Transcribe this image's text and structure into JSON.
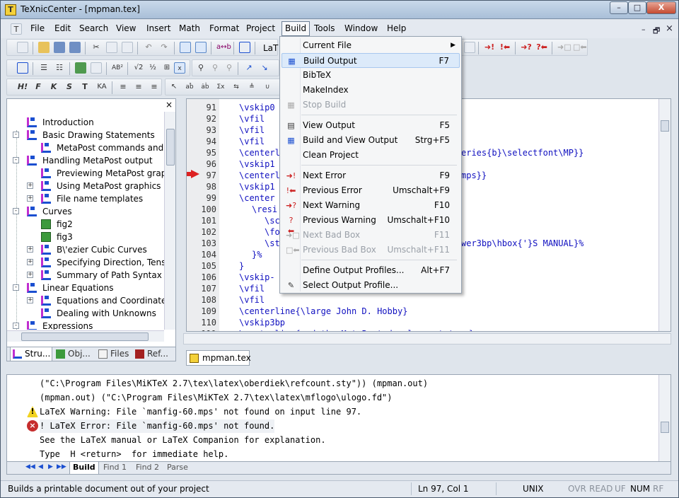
{
  "window": {
    "title": "TeXnicCenter - [mpman.tex]",
    "icon_letter": "T",
    "minimize": "–",
    "maximize": "□",
    "close": "X"
  },
  "menubar": {
    "items": [
      "File",
      "Edit",
      "Search",
      "View",
      "Insert",
      "Math",
      "Format",
      "Project",
      "Build",
      "Tools",
      "Window",
      "Help"
    ],
    "active": "Build",
    "mdi_minimize": "–",
    "mdi_restore": "🗗",
    "mdi_close": "×"
  },
  "toolbar": {
    "latex_combo": "LaT"
  },
  "build_menu": {
    "items": [
      {
        "label": "Current File",
        "key": "",
        "submenu": true,
        "disabled": false
      },
      {
        "label": "Build Output",
        "key": "F7",
        "highlighted": true,
        "disabled": false
      },
      {
        "label": "BibTeX",
        "key": "",
        "disabled": false
      },
      {
        "label": "MakeIndex",
        "key": "",
        "disabled": false
      },
      {
        "label": "Stop Build",
        "key": "",
        "disabled": true
      },
      {
        "label": "View Output",
        "key": "F5",
        "disabled": false
      },
      {
        "label": "Build and View Output",
        "key": "Strg+F5",
        "disabled": false
      },
      {
        "label": "Clean Project",
        "key": "",
        "disabled": false
      },
      {
        "label": "Next Error",
        "key": "F9",
        "disabled": false
      },
      {
        "label": "Previous Error",
        "key": "Umschalt+F9",
        "disabled": false
      },
      {
        "label": "Next Warning",
        "key": "F10",
        "disabled": false
      },
      {
        "label": "Previous Warning",
        "key": "Umschalt+F10",
        "disabled": false
      },
      {
        "label": "Next Bad Box",
        "key": "F11",
        "disabled": true
      },
      {
        "label": "Previous Bad Box",
        "key": "Umschalt+F11",
        "disabled": true
      },
      {
        "label": "Define Output Profiles...",
        "key": "Alt+F7",
        "disabled": false
      },
      {
        "label": "Select Output Profile...",
        "key": "",
        "disabled": false
      }
    ]
  },
  "structure": {
    "close": "×",
    "nodes": [
      {
        "label": "Introduction",
        "level": 1,
        "type": "section",
        "expander": ""
      },
      {
        "label": "Basic Drawing Statements",
        "level": 1,
        "type": "section",
        "expander": "-"
      },
      {
        "label": "MetaPost commands and the re",
        "level": 2,
        "type": "section",
        "expander": ""
      },
      {
        "label": "Handling MetaPost output",
        "level": 1,
        "type": "section",
        "expander": "-"
      },
      {
        "label": "Previewing MetaPost graphics",
        "level": 2,
        "type": "section",
        "expander": ""
      },
      {
        "label": "Using MetaPost graphics in \\Te",
        "level": 2,
        "type": "section",
        "expander": "+"
      },
      {
        "label": "File name templates",
        "level": 2,
        "type": "section",
        "expander": "+"
      },
      {
        "label": "Curves",
        "level": 1,
        "type": "section",
        "expander": "-"
      },
      {
        "label": "fig2",
        "level": 2,
        "type": "figure",
        "expander": ""
      },
      {
        "label": "fig3",
        "level": 2,
        "type": "figure",
        "expander": ""
      },
      {
        "label": "B\\'ezier Cubic Curves",
        "level": 2,
        "type": "section",
        "expander": "+"
      },
      {
        "label": "Specifying Direction, Tension, a",
        "level": 2,
        "type": "section",
        "expander": "+"
      },
      {
        "label": "Summary of Path Syntax",
        "level": 2,
        "type": "section",
        "expander": "+"
      },
      {
        "label": "Linear Equations",
        "level": 1,
        "type": "section",
        "expander": "-"
      },
      {
        "label": "Equations and Coordinate Pairs",
        "level": 2,
        "type": "section",
        "expander": "+"
      },
      {
        "label": "Dealing with Unknowns",
        "level": 2,
        "type": "section",
        "expander": ""
      },
      {
        "label": "Expressions",
        "level": 1,
        "type": "section",
        "expander": "-"
      }
    ],
    "tabs": [
      "Stru...",
      "Obj...",
      "Files",
      "Ref..."
    ]
  },
  "editor": {
    "tab_label": "mpman.tex",
    "lines": [
      {
        "n": "91",
        "text": "\\vskip0",
        "indent": 0
      },
      {
        "n": "92",
        "text": "\\vfil",
        "indent": 0
      },
      {
        "n": "93",
        "text": "\\vfil",
        "indent": 0
      },
      {
        "n": "94",
        "text": "\\vfil",
        "indent": 0
      },
      {
        "n": "95",
        "text": "\\centerl",
        "indent": 0,
        "tail": "eries{b}\\selectfont\\MP}}"
      },
      {
        "n": "96",
        "text": "\\vskip1",
        "indent": 0
      },
      {
        "n": "97",
        "text": "\\centerl",
        "indent": 0,
        "tail": "mps}}"
      },
      {
        "n": "98",
        "text": "\\vskip1",
        "indent": 0
      },
      {
        "n": "99",
        "text": "\\center",
        "indent": 0
      },
      {
        "n": "100",
        "text": "\\resi",
        "indent": 1
      },
      {
        "n": "101",
        "text": "\\sc",
        "indent": 2
      },
      {
        "n": "102",
        "text": "\\fo",
        "indent": 2
      },
      {
        "n": "103",
        "text": "\\st",
        "indent": 2,
        "tail": "wer3bp\\hbox{'}S MANUAL}%"
      },
      {
        "n": "104",
        "text": "}%",
        "indent": 1
      },
      {
        "n": "105",
        "text": "}",
        "indent": 0
      },
      {
        "n": "106",
        "text": "\\vskip-",
        "indent": 0
      },
      {
        "n": "107",
        "text": "\\vfil",
        "indent": 0
      },
      {
        "n": "108",
        "text": "\\vfil",
        "indent": 0
      },
      {
        "n": "109",
        "text": "\\centerline{\\large John D. Hobby}",
        "indent": 0
      },
      {
        "n": "110",
        "text": "\\vskip3bp",
        "indent": 0
      },
      {
        "n": "111",
        "text": "\\centerline{and the MetaPost development team}",
        "indent": 0
      }
    ],
    "error_line": "97"
  },
  "output": {
    "close": "×",
    "lines": [
      {
        "icon": "",
        "text": "(\"C:\\Program Files\\MiKTeX 2.7\\tex\\latex\\oberdiek\\refcount.sty\")) (mpman.out)"
      },
      {
        "icon": "",
        "text": "(mpman.out) (\"C:\\Program Files\\MiKTeX 2.7\\tex\\latex\\mflogo\\ulogo.fd\")"
      },
      {
        "icon": "warning",
        "text": "LaTeX Warning: File `manfig-60.mps' not found on input line 97."
      },
      {
        "icon": "error",
        "text": "! LaTeX Error: File `manfig-60.mps' not found."
      },
      {
        "icon": "",
        "text": "See the LaTeX manual or LaTeX Companion for explanation."
      },
      {
        "icon": "",
        "text": "Type  H <return>  for immediate help."
      }
    ],
    "tabs": [
      "Build",
      "Find 1",
      "Find 2",
      "Parse"
    ],
    "active_tab": "Build"
  },
  "statusbar": {
    "message": "Builds a printable document out of your project",
    "position": "Ln 97, Col 1",
    "lineend": "UNIX",
    "ovr": "OVR",
    "read": "READ",
    "uf": "UF",
    "num": "NUM",
    "rf": "RF"
  }
}
